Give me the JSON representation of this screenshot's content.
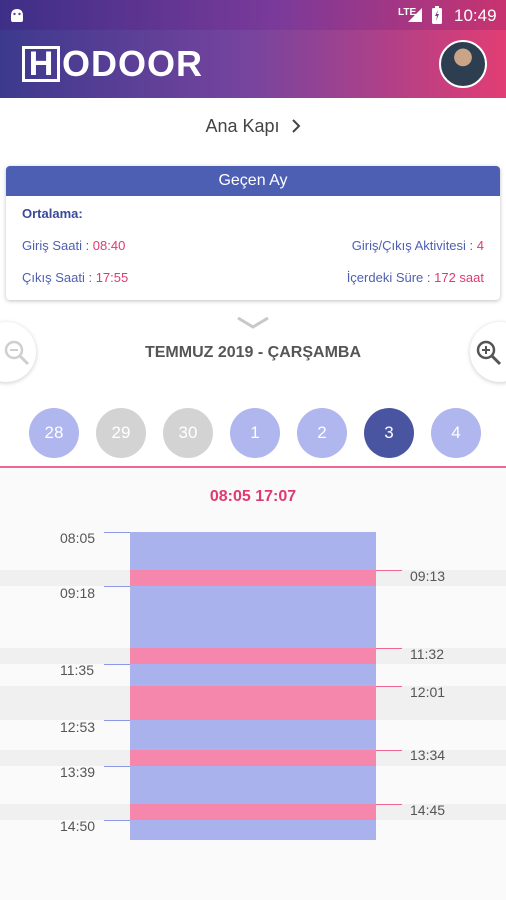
{
  "status_bar": {
    "time": "10:49",
    "network": "LTE"
  },
  "app": {
    "logo_h": "H",
    "logo_text": "ODOOR"
  },
  "door": {
    "name": "Ana Kapı"
  },
  "summary": {
    "header": "Geçen Ay",
    "subtitle": "Ortalama:",
    "entry_label": "Giriş Saati : ",
    "entry_value": "08:40",
    "exit_label": "Çıkış Saati : ",
    "exit_value": "17:55",
    "activity_label": "Giriş/Çıkış Aktivitesi : ",
    "activity_value": "4",
    "inside_label": "İçerdeki Süre : ",
    "inside_value": "172 saat"
  },
  "date_label": "TEMMUZ 2019 - ÇARŞAMBA",
  "days": [
    {
      "label": "28",
      "state": "cur"
    },
    {
      "label": "29",
      "state": "other"
    },
    {
      "label": "30",
      "state": "other"
    },
    {
      "label": "1",
      "state": "cur"
    },
    {
      "label": "2",
      "state": "cur"
    },
    {
      "label": "3",
      "state": "sel"
    },
    {
      "label": "4",
      "state": "cur"
    }
  ],
  "timeline": {
    "range": "08:05 17:07",
    "left_labels": [
      "08:05",
      "09:18",
      "11:35",
      "12:53",
      "13:39",
      "14:50"
    ],
    "right_labels": [
      "09:13",
      "11:32",
      "12:01",
      "13:34",
      "14:45"
    ]
  },
  "colors": {
    "accent": "#4d5fb3",
    "highlight": "#e03a6e",
    "inside": "#aab2ee",
    "outside": "#f587ad"
  }
}
